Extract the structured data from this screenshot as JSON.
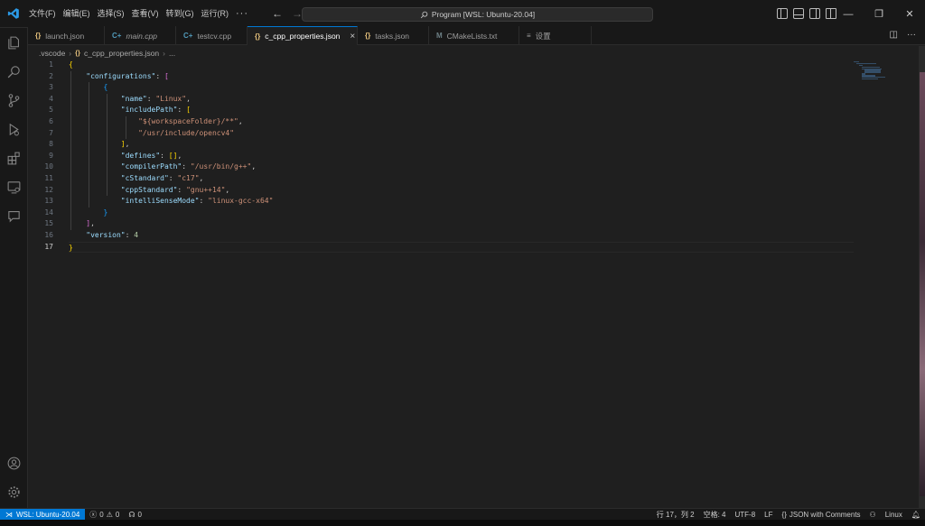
{
  "menu": [
    "文件(F)",
    "编辑(E)",
    "选择(S)",
    "查看(V)",
    "转到(G)",
    "运行(R)",
    "···"
  ],
  "search": {
    "text": "Program [WSL: Ubuntu-20.04]"
  },
  "tabs": [
    {
      "label": "launch.json",
      "icon": "{}",
      "type": "json"
    },
    {
      "label": "main.cpp",
      "icon": "C+",
      "type": "cpp",
      "italic": true
    },
    {
      "label": "testcv.cpp",
      "icon": "C+",
      "type": "cpp"
    },
    {
      "label": "c_cpp_properties.json",
      "icon": "{}",
      "type": "json",
      "active": true,
      "close": "×"
    },
    {
      "label": "tasks.json",
      "icon": "{}",
      "type": "json"
    },
    {
      "label": "CMakeLists.txt",
      "icon": "M",
      "type": "cmake"
    },
    {
      "label": "设置",
      "icon": "≡",
      "type": "settings"
    }
  ],
  "breadcrumb": {
    "folder": ".vscode",
    "file_icon": "{}",
    "file": "c_cpp_properties.json",
    "more": "..."
  },
  "line_numbers": [
    "1",
    "2",
    "3",
    "4",
    "5",
    "6",
    "7",
    "8",
    "9",
    "10",
    "11",
    "12",
    "13",
    "14",
    "15",
    "16",
    "17"
  ],
  "code": {
    "configurations_key": "\"configurations\"",
    "name_key": "\"name\"",
    "name_val": "\"Linux\"",
    "includePath_key": "\"includePath\"",
    "inc1": "\"${workspaceFolder}/**\"",
    "inc2": "\"/usr/include/opencv4\"",
    "defines_key": "\"defines\"",
    "compilerPath_key": "\"compilerPath\"",
    "compilerPath_val": "\"/usr/bin/g++\"",
    "cStandard_key": "\"cStandard\"",
    "cStandard_val": "\"c17\"",
    "cppStandard_key": "\"cppStandard\"",
    "cppStandard_val": "\"gnu++14\"",
    "intelliSenseMode_key": "\"intelliSenseMode\"",
    "intelliSenseMode_val": "\"linux-gcc-x64\"",
    "version_key": "\"version\"",
    "version_val": "4"
  },
  "status": {
    "remote": "WSL: Ubuntu-20.04",
    "errors": "0",
    "warnings": "0",
    "ports": "0",
    "position": "行 17，列 2",
    "spaces": "空格: 4",
    "encoding": "UTF-8",
    "eol": "LF",
    "language": "JSON with Comments",
    "os": "Linux"
  },
  "colors": {
    "accent": "#0078d4",
    "background": "#1f1f1f",
    "chrome": "#181818"
  }
}
